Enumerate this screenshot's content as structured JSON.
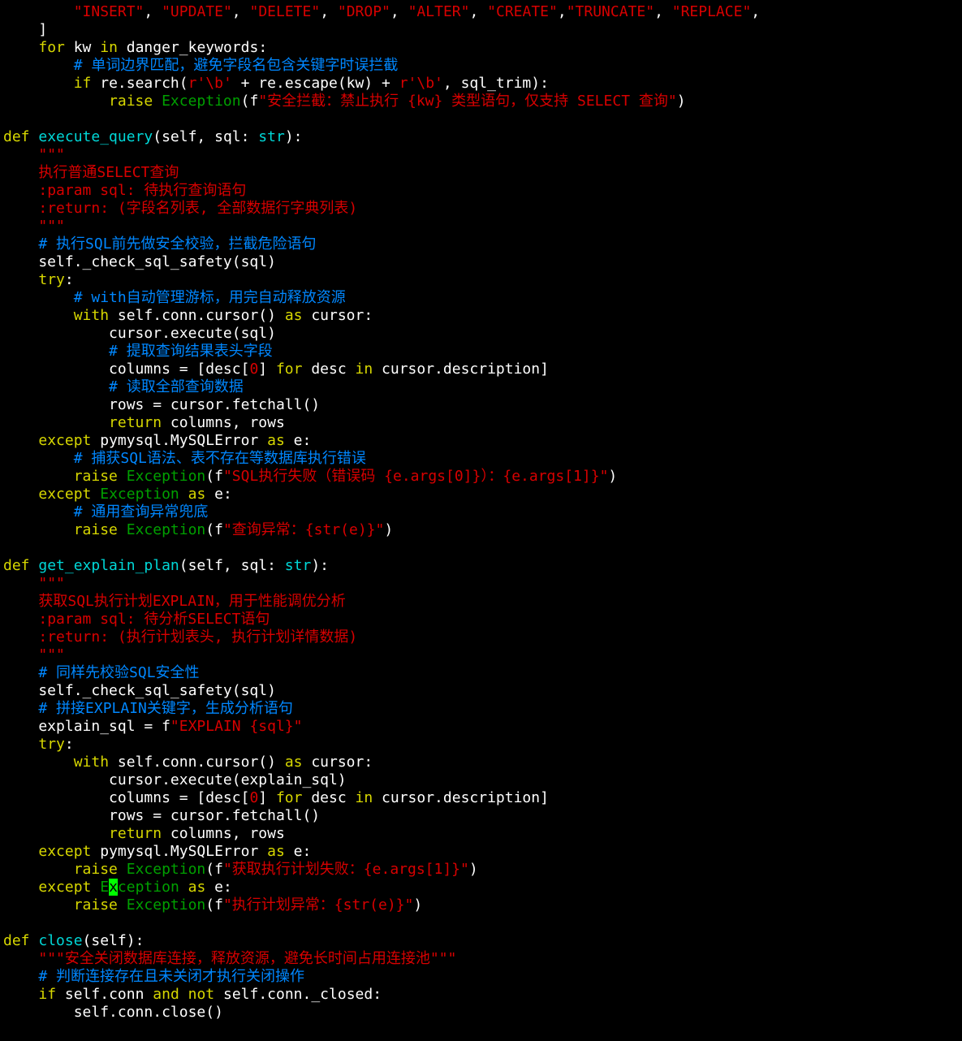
{
  "editor": {
    "lines": [
      {
        "parts": [
          {
            "t": "        ",
            "c": "def"
          },
          {
            "t": "\"INSERT\"",
            "c": "str"
          },
          {
            "t": ", ",
            "c": "def"
          },
          {
            "t": "\"UPDATE\"",
            "c": "str"
          },
          {
            "t": ", ",
            "c": "def"
          },
          {
            "t": "\"DELETE\"",
            "c": "str"
          },
          {
            "t": ", ",
            "c": "def"
          },
          {
            "t": "\"DROP\"",
            "c": "str"
          },
          {
            "t": ", ",
            "c": "def"
          },
          {
            "t": "\"ALTER\"",
            "c": "str"
          },
          {
            "t": ", ",
            "c": "def"
          },
          {
            "t": "\"CREATE\"",
            "c": "str"
          },
          {
            "t": ",",
            "c": "def"
          },
          {
            "t": "\"TRUNCATE\"",
            "c": "str"
          },
          {
            "t": ", ",
            "c": "def"
          },
          {
            "t": "\"REPLACE\"",
            "c": "str"
          },
          {
            "t": ",",
            "c": "def"
          }
        ]
      },
      {
        "parts": [
          {
            "t": "    ]",
            "c": "def"
          }
        ]
      },
      {
        "parts": [
          {
            "t": "    ",
            "c": "def"
          },
          {
            "t": "for",
            "c": "kw"
          },
          {
            "t": " kw ",
            "c": "def"
          },
          {
            "t": "in",
            "c": "kw"
          },
          {
            "t": " danger_keywords:",
            "c": "def"
          }
        ]
      },
      {
        "parts": [
          {
            "t": "        ",
            "c": "def"
          },
          {
            "t": "# 单词边界匹配，避免字段名包含关键字时误拦截",
            "c": "cm"
          }
        ]
      },
      {
        "parts": [
          {
            "t": "        ",
            "c": "def"
          },
          {
            "t": "if",
            "c": "kw"
          },
          {
            "t": " re.search(",
            "c": "def"
          },
          {
            "t": "r'\\b'",
            "c": "str"
          },
          {
            "t": " + re.escape(kw) + ",
            "c": "def"
          },
          {
            "t": "r'\\b'",
            "c": "str"
          },
          {
            "t": ", sql_trim):",
            "c": "def"
          }
        ]
      },
      {
        "parts": [
          {
            "t": "            ",
            "c": "def"
          },
          {
            "t": "raise",
            "c": "kw"
          },
          {
            "t": " ",
            "c": "def"
          },
          {
            "t": "Exception",
            "c": "cl"
          },
          {
            "t": "(f",
            "c": "def"
          },
          {
            "t": "\"安全拦截：禁止执行 {kw} 类型语句，仅支持 SELECT 查询\"",
            "c": "str"
          },
          {
            "t": ")",
            "c": "def"
          }
        ]
      },
      {
        "parts": [
          {
            "t": "",
            "c": "def"
          }
        ]
      },
      {
        "parts": [
          {
            "t": "def",
            "c": "kw"
          },
          {
            "t": " ",
            "c": "def"
          },
          {
            "t": "execute_query",
            "c": "fn"
          },
          {
            "t": "(self, sql: ",
            "c": "def"
          },
          {
            "t": "str",
            "c": "fn"
          },
          {
            "t": "):",
            "c": "def"
          }
        ]
      },
      {
        "parts": [
          {
            "t": "    ",
            "c": "def"
          },
          {
            "t": "\"\"\"",
            "c": "str"
          }
        ]
      },
      {
        "parts": [
          {
            "t": "    ",
            "c": "def"
          },
          {
            "t": "执行普通SELECT查询",
            "c": "str"
          }
        ]
      },
      {
        "parts": [
          {
            "t": "    ",
            "c": "def"
          },
          {
            "t": ":param sql: 待执行查询语句",
            "c": "str"
          }
        ]
      },
      {
        "parts": [
          {
            "t": "    ",
            "c": "def"
          },
          {
            "t": ":return: (字段名列表, 全部数据行字典列表)",
            "c": "str"
          }
        ]
      },
      {
        "parts": [
          {
            "t": "    ",
            "c": "def"
          },
          {
            "t": "\"\"\"",
            "c": "str"
          }
        ]
      },
      {
        "parts": [
          {
            "t": "    ",
            "c": "def"
          },
          {
            "t": "# 执行SQL前先做安全校验，拦截危险语句",
            "c": "cm"
          }
        ]
      },
      {
        "parts": [
          {
            "t": "    self._check_sql_safety(sql)",
            "c": "def"
          }
        ]
      },
      {
        "parts": [
          {
            "t": "    ",
            "c": "def"
          },
          {
            "t": "try",
            "c": "kw"
          },
          {
            "t": ":",
            "c": "def"
          }
        ]
      },
      {
        "parts": [
          {
            "t": "        ",
            "c": "def"
          },
          {
            "t": "# with自动管理游标，用完自动释放资源",
            "c": "cm"
          }
        ]
      },
      {
        "parts": [
          {
            "t": "        ",
            "c": "def"
          },
          {
            "t": "with",
            "c": "kw"
          },
          {
            "t": " self.conn.cursor() ",
            "c": "def"
          },
          {
            "t": "as",
            "c": "kw"
          },
          {
            "t": " cursor:",
            "c": "def"
          }
        ]
      },
      {
        "parts": [
          {
            "t": "            cursor.execute(sql)",
            "c": "def"
          }
        ]
      },
      {
        "parts": [
          {
            "t": "            ",
            "c": "def"
          },
          {
            "t": "# 提取查询结果表头字段",
            "c": "cm"
          }
        ]
      },
      {
        "parts": [
          {
            "t": "            columns = [desc[",
            "c": "def"
          },
          {
            "t": "0",
            "c": "str"
          },
          {
            "t": "] ",
            "c": "def"
          },
          {
            "t": "for",
            "c": "kw"
          },
          {
            "t": " desc ",
            "c": "def"
          },
          {
            "t": "in",
            "c": "kw"
          },
          {
            "t": " cursor.description]",
            "c": "def"
          }
        ]
      },
      {
        "parts": [
          {
            "t": "            ",
            "c": "def"
          },
          {
            "t": "# 读取全部查询数据",
            "c": "cm"
          }
        ]
      },
      {
        "parts": [
          {
            "t": "            rows = cursor.fetchall()",
            "c": "def"
          }
        ]
      },
      {
        "parts": [
          {
            "t": "            ",
            "c": "def"
          },
          {
            "t": "return",
            "c": "kw"
          },
          {
            "t": " columns, rows",
            "c": "def"
          }
        ]
      },
      {
        "parts": [
          {
            "t": "    ",
            "c": "def"
          },
          {
            "t": "except",
            "c": "kw"
          },
          {
            "t": " pymysql.MySQLError ",
            "c": "def"
          },
          {
            "t": "as",
            "c": "kw"
          },
          {
            "t": " e:",
            "c": "def"
          }
        ]
      },
      {
        "parts": [
          {
            "t": "        ",
            "c": "def"
          },
          {
            "t": "# 捕获SQL语法、表不存在等数据库执行错误",
            "c": "cm"
          }
        ]
      },
      {
        "parts": [
          {
            "t": "        ",
            "c": "def"
          },
          {
            "t": "raise",
            "c": "kw"
          },
          {
            "t": " ",
            "c": "def"
          },
          {
            "t": "Exception",
            "c": "cl"
          },
          {
            "t": "(f",
            "c": "def"
          },
          {
            "t": "\"SQL执行失败（错误码 {e.args[0]}）：{e.args[1]}\"",
            "c": "str"
          },
          {
            "t": ")",
            "c": "def"
          }
        ]
      },
      {
        "parts": [
          {
            "t": "    ",
            "c": "def"
          },
          {
            "t": "except",
            "c": "kw"
          },
          {
            "t": " ",
            "c": "def"
          },
          {
            "t": "Exception",
            "c": "cl"
          },
          {
            "t": " ",
            "c": "def"
          },
          {
            "t": "as",
            "c": "kw"
          },
          {
            "t": " e:",
            "c": "def"
          }
        ]
      },
      {
        "parts": [
          {
            "t": "        ",
            "c": "def"
          },
          {
            "t": "# 通用查询异常兜底",
            "c": "cm"
          }
        ]
      },
      {
        "parts": [
          {
            "t": "        ",
            "c": "def"
          },
          {
            "t": "raise",
            "c": "kw"
          },
          {
            "t": " ",
            "c": "def"
          },
          {
            "t": "Exception",
            "c": "cl"
          },
          {
            "t": "(f",
            "c": "def"
          },
          {
            "t": "\"查询异常：{str(e)}\"",
            "c": "str"
          },
          {
            "t": ")",
            "c": "def"
          }
        ]
      },
      {
        "parts": [
          {
            "t": "",
            "c": "def"
          }
        ]
      },
      {
        "parts": [
          {
            "t": "def",
            "c": "kw"
          },
          {
            "t": " ",
            "c": "def"
          },
          {
            "t": "get_explain_plan",
            "c": "fn"
          },
          {
            "t": "(self, sql: ",
            "c": "def"
          },
          {
            "t": "str",
            "c": "fn"
          },
          {
            "t": "):",
            "c": "def"
          }
        ]
      },
      {
        "parts": [
          {
            "t": "    ",
            "c": "def"
          },
          {
            "t": "\"\"\"",
            "c": "str"
          }
        ]
      },
      {
        "parts": [
          {
            "t": "    ",
            "c": "def"
          },
          {
            "t": "获取SQL执行计划EXPLAIN，用于性能调优分析",
            "c": "str"
          }
        ]
      },
      {
        "parts": [
          {
            "t": "    ",
            "c": "def"
          },
          {
            "t": ":param sql: 待分析SELECT语句",
            "c": "str"
          }
        ]
      },
      {
        "parts": [
          {
            "t": "    ",
            "c": "def"
          },
          {
            "t": ":return: (执行计划表头, 执行计划详情数据)",
            "c": "str"
          }
        ]
      },
      {
        "parts": [
          {
            "t": "    ",
            "c": "def"
          },
          {
            "t": "\"\"\"",
            "c": "str"
          }
        ]
      },
      {
        "parts": [
          {
            "t": "    ",
            "c": "def"
          },
          {
            "t": "# 同样先校验SQL安全性",
            "c": "cm"
          }
        ]
      },
      {
        "parts": [
          {
            "t": "    self._check_sql_safety(sql)",
            "c": "def"
          }
        ]
      },
      {
        "parts": [
          {
            "t": "    ",
            "c": "def"
          },
          {
            "t": "# 拼接EXPLAIN关键字，生成分析语句",
            "c": "cm"
          }
        ]
      },
      {
        "parts": [
          {
            "t": "    explain_sql = f",
            "c": "def"
          },
          {
            "t": "\"EXPLAIN {sql}\"",
            "c": "str"
          }
        ]
      },
      {
        "parts": [
          {
            "t": "    ",
            "c": "def"
          },
          {
            "t": "try",
            "c": "kw"
          },
          {
            "t": ":",
            "c": "def"
          }
        ]
      },
      {
        "parts": [
          {
            "t": "        ",
            "c": "def"
          },
          {
            "t": "with",
            "c": "kw"
          },
          {
            "t": " self.conn.cursor() ",
            "c": "def"
          },
          {
            "t": "as",
            "c": "kw"
          },
          {
            "t": " cursor:",
            "c": "def"
          }
        ]
      },
      {
        "parts": [
          {
            "t": "            cursor.execute(explain_sql)",
            "c": "def"
          }
        ]
      },
      {
        "parts": [
          {
            "t": "            columns = [desc[",
            "c": "def"
          },
          {
            "t": "0",
            "c": "str"
          },
          {
            "t": "] ",
            "c": "def"
          },
          {
            "t": "for",
            "c": "kw"
          },
          {
            "t": " desc ",
            "c": "def"
          },
          {
            "t": "in",
            "c": "kw"
          },
          {
            "t": " cursor.description]",
            "c": "def"
          }
        ]
      },
      {
        "parts": [
          {
            "t": "            rows = cursor.fetchall()",
            "c": "def"
          }
        ]
      },
      {
        "parts": [
          {
            "t": "            ",
            "c": "def"
          },
          {
            "t": "return",
            "c": "kw"
          },
          {
            "t": " columns, rows",
            "c": "def"
          }
        ]
      },
      {
        "parts": [
          {
            "t": "    ",
            "c": "def"
          },
          {
            "t": "except",
            "c": "kw"
          },
          {
            "t": " pymysql.MySQLError ",
            "c": "def"
          },
          {
            "t": "as",
            "c": "kw"
          },
          {
            "t": " e:",
            "c": "def"
          }
        ]
      },
      {
        "parts": [
          {
            "t": "        ",
            "c": "def"
          },
          {
            "t": "raise",
            "c": "kw"
          },
          {
            "t": " ",
            "c": "def"
          },
          {
            "t": "Exception",
            "c": "cl"
          },
          {
            "t": "(f",
            "c": "def"
          },
          {
            "t": "\"获取执行计划失败：{e.args[1]}\"",
            "c": "str"
          },
          {
            "t": ")",
            "c": "def"
          }
        ]
      },
      {
        "parts": [
          {
            "t": "    ",
            "c": "def"
          },
          {
            "t": "except",
            "c": "kw"
          },
          {
            "t": " ",
            "c": "def"
          },
          {
            "t": "E",
            "c": "cl"
          },
          {
            "t": "x",
            "c": "cur"
          },
          {
            "t": "ception",
            "c": "cl"
          },
          {
            "t": " ",
            "c": "def"
          },
          {
            "t": "as",
            "c": "kw"
          },
          {
            "t": " e:",
            "c": "def"
          }
        ]
      },
      {
        "parts": [
          {
            "t": "        ",
            "c": "def"
          },
          {
            "t": "raise",
            "c": "kw"
          },
          {
            "t": " ",
            "c": "def"
          },
          {
            "t": "Exception",
            "c": "cl"
          },
          {
            "t": "(f",
            "c": "def"
          },
          {
            "t": "\"执行计划异常：{str(e)}\"",
            "c": "str"
          },
          {
            "t": ")",
            "c": "def"
          }
        ]
      },
      {
        "parts": [
          {
            "t": "",
            "c": "def"
          }
        ]
      },
      {
        "parts": [
          {
            "t": "def",
            "c": "kw"
          },
          {
            "t": " ",
            "c": "def"
          },
          {
            "t": "close",
            "c": "fn"
          },
          {
            "t": "(self):",
            "c": "def"
          }
        ]
      },
      {
        "parts": [
          {
            "t": "    ",
            "c": "def"
          },
          {
            "t": "\"\"\"安全关闭数据库连接，释放资源，避免长时间占用连接池\"\"\"",
            "c": "str"
          }
        ]
      },
      {
        "parts": [
          {
            "t": "    ",
            "c": "def"
          },
          {
            "t": "# 判断连接存在且未关闭才执行关闭操作",
            "c": "cm"
          }
        ]
      },
      {
        "parts": [
          {
            "t": "    ",
            "c": "def"
          },
          {
            "t": "if",
            "c": "kw"
          },
          {
            "t": " self.conn ",
            "c": "def"
          },
          {
            "t": "and",
            "c": "kw"
          },
          {
            "t": " ",
            "c": "def"
          },
          {
            "t": "not",
            "c": "kw"
          },
          {
            "t": " self.conn._closed:",
            "c": "def"
          }
        ]
      },
      {
        "parts": [
          {
            "t": "        self.conn.close()",
            "c": "def"
          }
        ]
      }
    ]
  }
}
